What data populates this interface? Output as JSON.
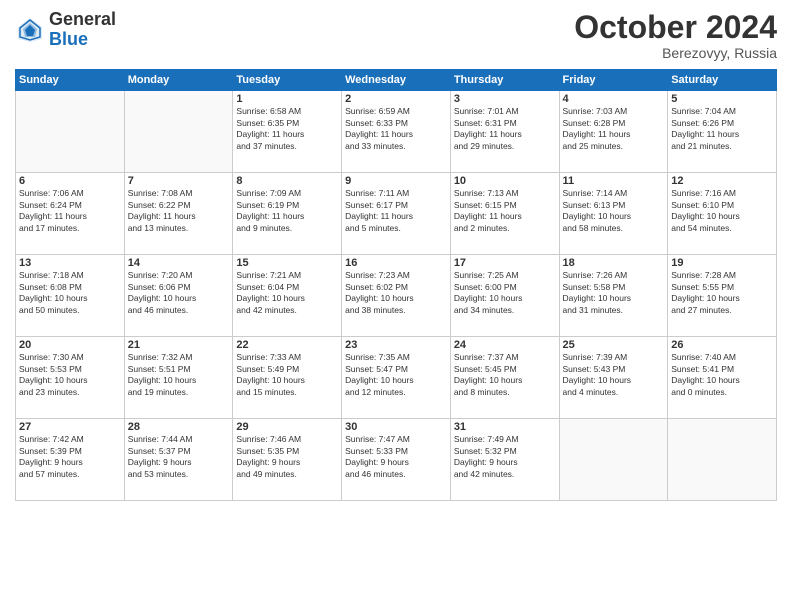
{
  "header": {
    "logo_general": "General",
    "logo_blue": "Blue",
    "month_title": "October 2024",
    "location": "Berezovyy, Russia"
  },
  "days_of_week": [
    "Sunday",
    "Monday",
    "Tuesday",
    "Wednesday",
    "Thursday",
    "Friday",
    "Saturday"
  ],
  "weeks": [
    [
      {
        "day": "",
        "info": ""
      },
      {
        "day": "",
        "info": ""
      },
      {
        "day": "1",
        "info": "Sunrise: 6:58 AM\nSunset: 6:35 PM\nDaylight: 11 hours\nand 37 minutes."
      },
      {
        "day": "2",
        "info": "Sunrise: 6:59 AM\nSunset: 6:33 PM\nDaylight: 11 hours\nand 33 minutes."
      },
      {
        "day": "3",
        "info": "Sunrise: 7:01 AM\nSunset: 6:31 PM\nDaylight: 11 hours\nand 29 minutes."
      },
      {
        "day": "4",
        "info": "Sunrise: 7:03 AM\nSunset: 6:28 PM\nDaylight: 11 hours\nand 25 minutes."
      },
      {
        "day": "5",
        "info": "Sunrise: 7:04 AM\nSunset: 6:26 PM\nDaylight: 11 hours\nand 21 minutes."
      }
    ],
    [
      {
        "day": "6",
        "info": "Sunrise: 7:06 AM\nSunset: 6:24 PM\nDaylight: 11 hours\nand 17 minutes."
      },
      {
        "day": "7",
        "info": "Sunrise: 7:08 AM\nSunset: 6:22 PM\nDaylight: 11 hours\nand 13 minutes."
      },
      {
        "day": "8",
        "info": "Sunrise: 7:09 AM\nSunset: 6:19 PM\nDaylight: 11 hours\nand 9 minutes."
      },
      {
        "day": "9",
        "info": "Sunrise: 7:11 AM\nSunset: 6:17 PM\nDaylight: 11 hours\nand 5 minutes."
      },
      {
        "day": "10",
        "info": "Sunrise: 7:13 AM\nSunset: 6:15 PM\nDaylight: 11 hours\nand 2 minutes."
      },
      {
        "day": "11",
        "info": "Sunrise: 7:14 AM\nSunset: 6:13 PM\nDaylight: 10 hours\nand 58 minutes."
      },
      {
        "day": "12",
        "info": "Sunrise: 7:16 AM\nSunset: 6:10 PM\nDaylight: 10 hours\nand 54 minutes."
      }
    ],
    [
      {
        "day": "13",
        "info": "Sunrise: 7:18 AM\nSunset: 6:08 PM\nDaylight: 10 hours\nand 50 minutes."
      },
      {
        "day": "14",
        "info": "Sunrise: 7:20 AM\nSunset: 6:06 PM\nDaylight: 10 hours\nand 46 minutes."
      },
      {
        "day": "15",
        "info": "Sunrise: 7:21 AM\nSunset: 6:04 PM\nDaylight: 10 hours\nand 42 minutes."
      },
      {
        "day": "16",
        "info": "Sunrise: 7:23 AM\nSunset: 6:02 PM\nDaylight: 10 hours\nand 38 minutes."
      },
      {
        "day": "17",
        "info": "Sunrise: 7:25 AM\nSunset: 6:00 PM\nDaylight: 10 hours\nand 34 minutes."
      },
      {
        "day": "18",
        "info": "Sunrise: 7:26 AM\nSunset: 5:58 PM\nDaylight: 10 hours\nand 31 minutes."
      },
      {
        "day": "19",
        "info": "Sunrise: 7:28 AM\nSunset: 5:55 PM\nDaylight: 10 hours\nand 27 minutes."
      }
    ],
    [
      {
        "day": "20",
        "info": "Sunrise: 7:30 AM\nSunset: 5:53 PM\nDaylight: 10 hours\nand 23 minutes."
      },
      {
        "day": "21",
        "info": "Sunrise: 7:32 AM\nSunset: 5:51 PM\nDaylight: 10 hours\nand 19 minutes."
      },
      {
        "day": "22",
        "info": "Sunrise: 7:33 AM\nSunset: 5:49 PM\nDaylight: 10 hours\nand 15 minutes."
      },
      {
        "day": "23",
        "info": "Sunrise: 7:35 AM\nSunset: 5:47 PM\nDaylight: 10 hours\nand 12 minutes."
      },
      {
        "day": "24",
        "info": "Sunrise: 7:37 AM\nSunset: 5:45 PM\nDaylight: 10 hours\nand 8 minutes."
      },
      {
        "day": "25",
        "info": "Sunrise: 7:39 AM\nSunset: 5:43 PM\nDaylight: 10 hours\nand 4 minutes."
      },
      {
        "day": "26",
        "info": "Sunrise: 7:40 AM\nSunset: 5:41 PM\nDaylight: 10 hours\nand 0 minutes."
      }
    ],
    [
      {
        "day": "27",
        "info": "Sunrise: 7:42 AM\nSunset: 5:39 PM\nDaylight: 9 hours\nand 57 minutes."
      },
      {
        "day": "28",
        "info": "Sunrise: 7:44 AM\nSunset: 5:37 PM\nDaylight: 9 hours\nand 53 minutes."
      },
      {
        "day": "29",
        "info": "Sunrise: 7:46 AM\nSunset: 5:35 PM\nDaylight: 9 hours\nand 49 minutes."
      },
      {
        "day": "30",
        "info": "Sunrise: 7:47 AM\nSunset: 5:33 PM\nDaylight: 9 hours\nand 46 minutes."
      },
      {
        "day": "31",
        "info": "Sunrise: 7:49 AM\nSunset: 5:32 PM\nDaylight: 9 hours\nand 42 minutes."
      },
      {
        "day": "",
        "info": ""
      },
      {
        "day": "",
        "info": ""
      }
    ]
  ]
}
